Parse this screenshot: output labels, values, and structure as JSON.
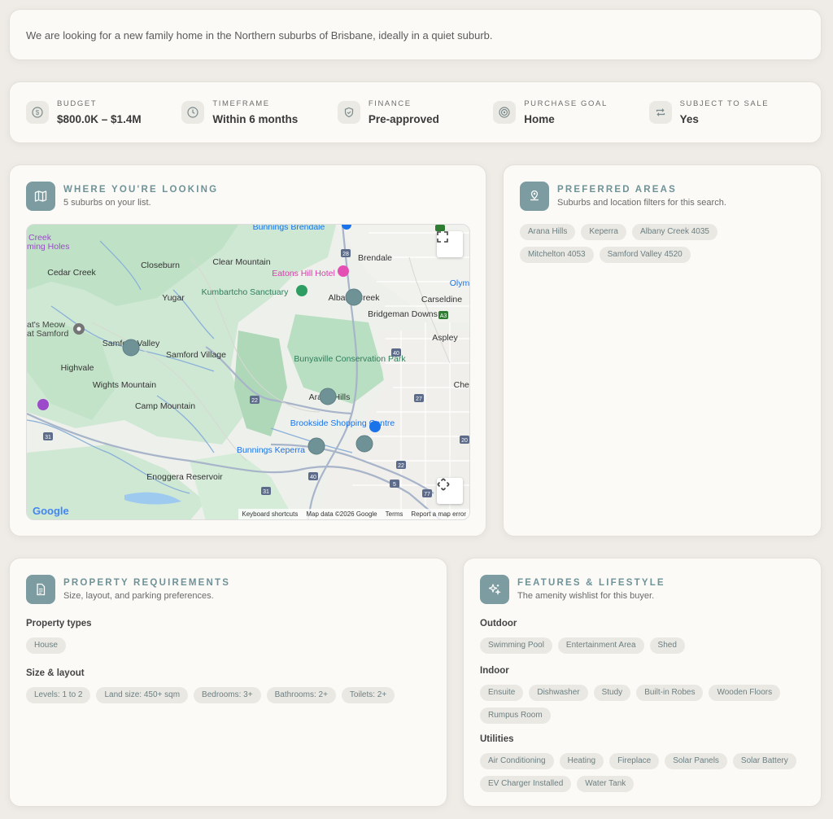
{
  "intro": {
    "text": "We are looking for a new family home in the Northern suburbs of Brisbane, ideally in a quiet suburb."
  },
  "stats": [
    {
      "label": "BUDGET",
      "value": "$800.0K – $1.4M",
      "icon": "dollar-icon"
    },
    {
      "label": "TIMEFRAME",
      "value": "Within 6 months",
      "icon": "clock-icon"
    },
    {
      "label": "FINANCE",
      "value": "Pre-approved",
      "icon": "shield-icon"
    },
    {
      "label": "PURCHASE GOAL",
      "value": "Home",
      "icon": "target-icon"
    },
    {
      "label": "SUBJECT TO SALE",
      "value": "Yes",
      "icon": "repeat-icon"
    }
  ],
  "map_section": {
    "title": "WHERE YOU'RE LOOKING",
    "subtitle": "5 suburbs on your list.",
    "map": {
      "labels": {
        "cedar_creek": "Cedar Creek",
        "closeburn": "Closeburn",
        "clear_mountain": "Clear Mountain",
        "eatons_hill": "Eatons Hill Hotel",
        "brendale": "Brendale",
        "bunnings_brendale": "Bunnings Brendale",
        "kumbartcho": "Kumbartcho Sanctuary",
        "yugar": "Yugar",
        "albany_creek": "Albany Creek",
        "carseldine": "Carseldine",
        "bridgeman_downs": "Bridgeman Downs",
        "aspley": "Aspley",
        "samford_valley": "Samford Valley",
        "samford_village": "Samford Village",
        "highvale": "Highvale",
        "wights_mountain": "Wights Mountain",
        "bunyaville": "Bunyaville Conservation Park",
        "camp_mountain": "Camp Mountain",
        "arana_hills": "Arana Hills",
        "brookside": "Brookside Shopping Centre",
        "bunnings_keperra": "Bunnings Keperra",
        "enoggera": "Enoggera Reservoir",
        "creek_holes": "Creek",
        "swimming_holes": "ming Holes",
        "cats_meow": "at's Meow",
        "at_samford": "at Samford",
        "olym": "Olym",
        "cher": "Cher"
      },
      "footer": {
        "shortcuts": "Keyboard shortcuts",
        "mapdata": "Map data ©2026 Google",
        "terms": "Terms",
        "report": "Report a map error"
      },
      "logo": "Google"
    }
  },
  "areas_section": {
    "title": "PREFERRED AREAS",
    "subtitle": "Suburbs and location filters for this search.",
    "chips": [
      "Arana Hills",
      "Keperra",
      "Albany Creek 4035",
      "Mitchelton 4053",
      "Samford Valley 4520"
    ]
  },
  "requirements_section": {
    "title": "PROPERTY REQUIREMENTS",
    "subtitle": "Size, layout, and parking preferences.",
    "types_heading": "Property types",
    "types": [
      "House"
    ],
    "size_heading": "Size & layout",
    "size": [
      "Levels: 1 to 2",
      "Land size: 450+ sqm",
      "Bedrooms: 3+",
      "Bathrooms: 2+",
      "Toilets: 2+"
    ]
  },
  "features_section": {
    "title": "FEATURES & LIFESTYLE",
    "subtitle": "The amenity wishlist for this buyer.",
    "outdoor_heading": "Outdoor",
    "outdoor": [
      "Swimming Pool",
      "Entertainment Area",
      "Shed"
    ],
    "indoor_heading": "Indoor",
    "indoor": [
      "Ensuite",
      "Dishwasher",
      "Study",
      "Built-in Robes",
      "Wooden Floors",
      "Rumpus Room"
    ],
    "utilities_heading": "Utilities",
    "utilities": [
      "Air Conditioning",
      "Heating",
      "Fireplace",
      "Solar Panels",
      "Solar Battery",
      "EV Charger Installed",
      "Water Tank"
    ]
  }
}
